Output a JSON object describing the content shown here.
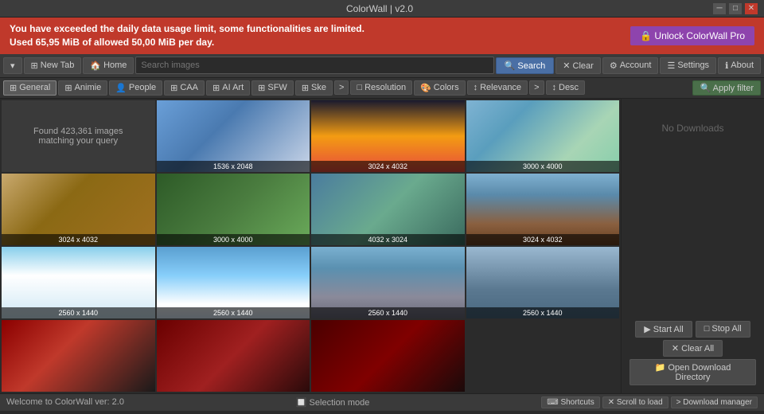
{
  "app": {
    "title": "ColorWall | v2.0",
    "window_controls": {
      "minimize": "─",
      "maximize": "□",
      "close": "✕"
    }
  },
  "warning": {
    "line1": "You have exceeded the daily data usage limit, some functionalities are limited.",
    "line2": "Used 65,95 MiB of allowed 50,00 MiB per day.",
    "unlock_label": "🔒 Unlock ColorWall Pro"
  },
  "toolbar": {
    "new_tab_label": "New Tab",
    "home_label": "Home",
    "search_placeholder": "Search images",
    "search_btn_label": "Search",
    "clear_btn_label": "Clear",
    "account_label": "Account",
    "settings_label": "Settings",
    "about_label": "About"
  },
  "filters": {
    "items": [
      {
        "label": "General",
        "icon": "⊞",
        "active": true
      },
      {
        "label": "Animie",
        "icon": "⊞",
        "active": false
      },
      {
        "label": "People",
        "icon": "👤",
        "active": false
      },
      {
        "label": "CAA",
        "icon": "⊞",
        "active": false
      },
      {
        "label": "AI Art",
        "icon": "⊞",
        "active": false
      },
      {
        "label": "SFW",
        "icon": "⊞",
        "active": false
      },
      {
        "label": "Ske",
        "icon": "⊞",
        "active": false
      }
    ],
    "more_label": ">",
    "resolution_label": "Resolution",
    "colors_label": "Colors",
    "relevance_label": "Relevance",
    "more2_label": ">",
    "desc_label": "Desc",
    "apply_filter_label": "Apply filter"
  },
  "results": {
    "info_text": "Found 423,361 images\nmatching your query"
  },
  "images": [
    {
      "size": "1536 x 2048",
      "style": "img-waterfall"
    },
    {
      "size": "3024 x 4032",
      "style": "img-sunset"
    },
    {
      "size": "3000 x 4000",
      "style": "img-river"
    },
    {
      "size": "3024 x 4032",
      "style": "img-canyon"
    },
    {
      "size": "3000 x 4000",
      "style": "img-forest"
    },
    {
      "size": "4032 x 3024",
      "style": "img-gorge"
    },
    {
      "size": "3024 x 4032",
      "style": "img-rocky"
    },
    {
      "size": "2560 x 1440",
      "style": "img-sky1"
    },
    {
      "size": "2560 x 1440",
      "style": "img-sky2"
    },
    {
      "size": "2560 x 1440",
      "style": "img-castle"
    },
    {
      "size": "2560 x 1440",
      "style": "img-ship"
    },
    {
      "size": "",
      "style": "img-spider1"
    },
    {
      "size": "",
      "style": "img-spider2"
    },
    {
      "size": "",
      "style": "img-spider3"
    }
  ],
  "right_panel": {
    "no_downloads": "No Downloads"
  },
  "download_manager": {
    "start_all_label": "▶ Start All",
    "stop_all_label": "□ Stop All",
    "clear_all_label": "✕ Clear All",
    "open_dir_label": "📁 Open Download Directory"
  },
  "status_bar": {
    "welcome": "Welcome to ColorWall ver: 2.0",
    "selection_mode": "🔲 Selection mode",
    "shortcuts": "⌨ Shortcuts",
    "scroll_to_load": "✕ Scroll to load",
    "download_manager": "> Download manager"
  }
}
